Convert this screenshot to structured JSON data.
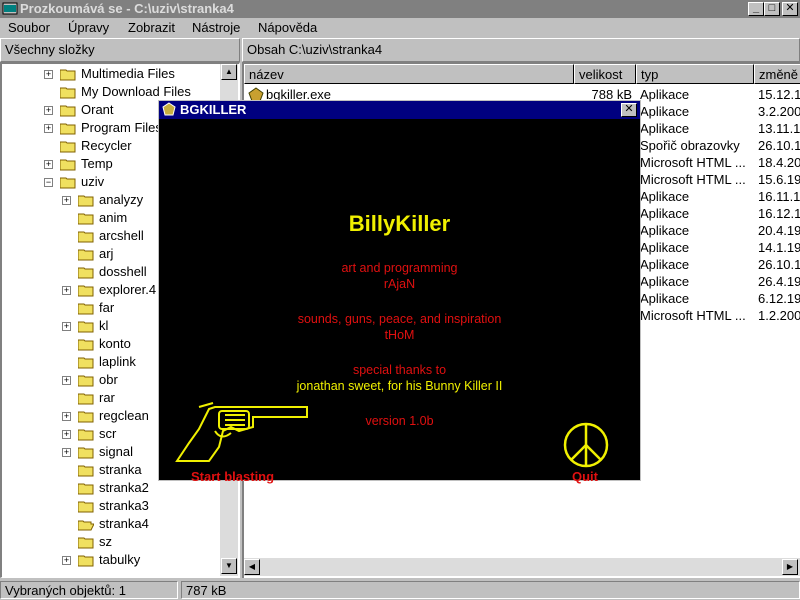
{
  "window": {
    "title": "Prozkoumává se - C:\\uziv\\stranka4",
    "buttons": {
      "minimize": "_",
      "maximize": "□",
      "close": "✕"
    }
  },
  "menu": [
    "Soubor",
    "Úpravy",
    "Zobrazit",
    "Nástroje",
    "Nápověda"
  ],
  "left_header": "Všechny složky",
  "right_header": "Obsah C:\\uziv\\stranka4",
  "tree": [
    {
      "label": "Multimedia Files",
      "expander": "+",
      "depth": 0
    },
    {
      "label": "My Download Files",
      "expander": "",
      "depth": 0
    },
    {
      "label": "Orant",
      "expander": "+",
      "depth": 0
    },
    {
      "label": "Program Files",
      "expander": "+",
      "depth": 0
    },
    {
      "label": "Recycler",
      "expander": "",
      "depth": 0
    },
    {
      "label": "Temp",
      "expander": "+",
      "depth": 0
    },
    {
      "label": "uziv",
      "expander": "−",
      "depth": 0
    },
    {
      "label": "analyzy",
      "expander": "+",
      "depth": 1
    },
    {
      "label": "anim",
      "expander": "",
      "depth": 1
    },
    {
      "label": "arcshell",
      "expander": "",
      "depth": 1
    },
    {
      "label": "arj",
      "expander": "",
      "depth": 1
    },
    {
      "label": "dosshell",
      "expander": "",
      "depth": 1
    },
    {
      "label": "explorer.4",
      "expander": "+",
      "depth": 1
    },
    {
      "label": "far",
      "expander": "",
      "depth": 1
    },
    {
      "label": "kl",
      "expander": "+",
      "depth": 1
    },
    {
      "label": "konto",
      "expander": "",
      "depth": 1
    },
    {
      "label": "laplink",
      "expander": "",
      "depth": 1
    },
    {
      "label": "obr",
      "expander": "+",
      "depth": 1
    },
    {
      "label": "rar",
      "expander": "",
      "depth": 1
    },
    {
      "label": "regclean",
      "expander": "+",
      "depth": 1
    },
    {
      "label": "scr",
      "expander": "+",
      "depth": 1
    },
    {
      "label": "signal",
      "expander": "+",
      "depth": 1
    },
    {
      "label": "stranka",
      "expander": "",
      "depth": 1
    },
    {
      "label": "stranka2",
      "expander": "",
      "depth": 1
    },
    {
      "label": "stranka3",
      "expander": "",
      "depth": 1
    },
    {
      "label": "stranka4",
      "expander": "",
      "depth": 1,
      "open": true
    },
    {
      "label": "sz",
      "expander": "",
      "depth": 1
    },
    {
      "label": "tabulky",
      "expander": "+",
      "depth": 1
    }
  ],
  "columns": [
    "název",
    "velikost",
    "typ",
    "změně"
  ],
  "files": [
    {
      "name": "bgkiller.exe",
      "size": "788 kB",
      "type": "Aplikace",
      "modified": "15.12.1"
    },
    {
      "name": "",
      "size": "",
      "type": "Aplikace",
      "modified": "3.2.200"
    },
    {
      "name": "",
      "size": "",
      "type": "Aplikace",
      "modified": "13.11.1"
    },
    {
      "name": "",
      "size": "",
      "type": "Spořič obrazovky",
      "modified": "26.10.1"
    },
    {
      "name": "",
      "size": "",
      "type": "Microsoft HTML ...",
      "modified": "18.4.20"
    },
    {
      "name": "",
      "size": "",
      "type": "Microsoft HTML ...",
      "modified": "15.6.19"
    },
    {
      "name": "",
      "size": "",
      "type": "Aplikace",
      "modified": "16.11.1"
    },
    {
      "name": "",
      "size": "",
      "type": "Aplikace",
      "modified": "16.12.1"
    },
    {
      "name": "",
      "size": "",
      "type": "Aplikace",
      "modified": "20.4.19"
    },
    {
      "name": "",
      "size": "",
      "type": "Aplikace",
      "modified": "14.1.19"
    },
    {
      "name": "",
      "size": "",
      "type": "Aplikace",
      "modified": "26.10.1"
    },
    {
      "name": "",
      "size": "",
      "type": "Aplikace",
      "modified": "26.4.19"
    },
    {
      "name": "",
      "size": "",
      "type": "Aplikace",
      "modified": "6.12.19"
    },
    {
      "name": "",
      "size": "",
      "type": "Microsoft HTML ...",
      "modified": "1.2.200"
    }
  ],
  "status": {
    "selected": "Vybraných objektů: 1",
    "size": "787 kB"
  },
  "dialog": {
    "title": "BGKILLER",
    "heading": "BillyKiller",
    "art_label": "art and programming",
    "art_name": "rAjaN",
    "sound_label": "sounds, guns, peace, and inspiration",
    "sound_name": "tHoM",
    "thanks_label": "special thanks to",
    "thanks_name": "jonathan sweet, for his Bunny Killer II",
    "version": "version 1.0b",
    "start_label": "Start blasting",
    "quit_label": "Quit",
    "colors": {
      "accent_red": "#e01010",
      "accent_yellow": "#f0f000",
      "background": "#000000"
    }
  }
}
